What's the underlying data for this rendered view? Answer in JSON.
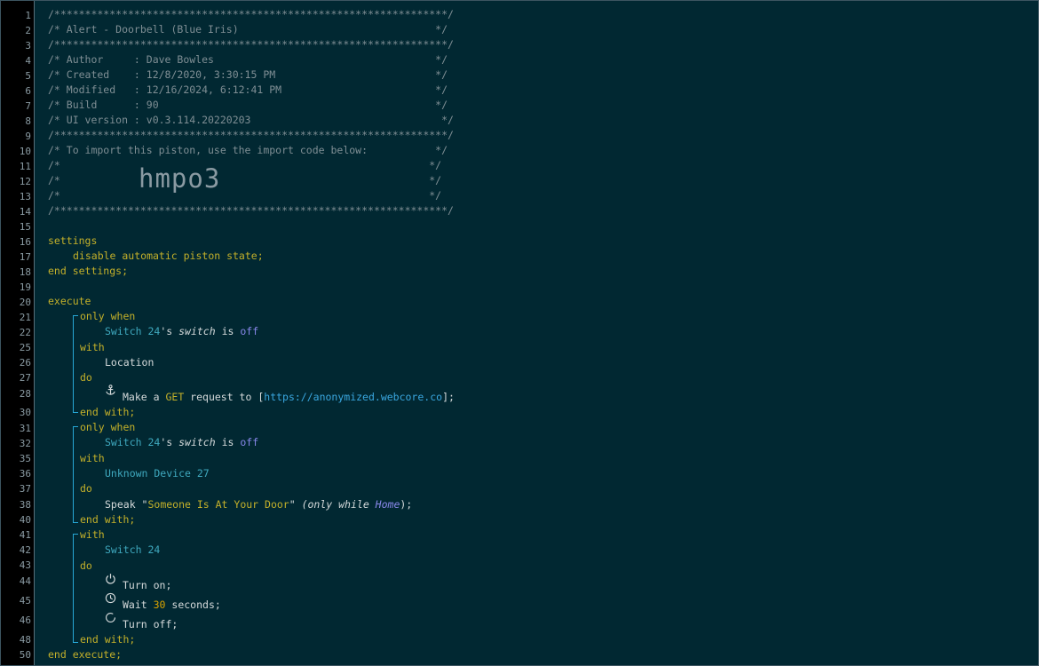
{
  "line_numbers": [
    "1",
    "2",
    "3",
    "4",
    "5",
    "6",
    "7",
    "8",
    "9",
    "10",
    "11",
    "12",
    "13",
    "14",
    "15",
    "16",
    "17",
    "18",
    "19",
    "20",
    "21",
    "22",
    "25",
    "26",
    "27",
    "28",
    "30",
    "31",
    "32",
    "35",
    "36",
    "37",
    "38",
    "40",
    "41",
    "42",
    "43",
    "44",
    "45",
    "46",
    "48",
    "50"
  ],
  "header": {
    "border": "/****************************************************************/",
    "title_line": "/* Alert - Doorbell (Blue Iris)                                */",
    "author_line": "/* Author     : Dave Bowles                                    */",
    "created_line": "/* Created    : 12/8/2020, 3:30:15 PM                          */",
    "modified_line": "/* Modified   : 12/16/2024, 6:12:41 PM                         */",
    "build_line": "/* Build      : 90                                             */",
    "ui_line": "/* UI version : v0.3.114.20220203                               */",
    "import_line": "/* To import this piston, use the import code below:           */",
    "blank_line": "/*                                                            */",
    "import_code": "hmpo3"
  },
  "settings": {
    "open": "settings",
    "body": "disable automatic piston state;",
    "close": "end settings;"
  },
  "execute": {
    "open": "execute",
    "close": "end execute;"
  },
  "block1": {
    "only_when": "only when",
    "device": "Switch 24",
    "possessive": "'s ",
    "attribute": "switch",
    "is": " is ",
    "value": "off",
    "with": "with",
    "target": "Location",
    "do": "do",
    "task_prefix": "Make a ",
    "method": "GET",
    "task_mid": " request to [",
    "url": "https://anonymized.webcore.co",
    "task_suffix": "];",
    "end": "end with;"
  },
  "block2": {
    "only_when": "only when",
    "device": "Switch 24",
    "possessive": "'s ",
    "attribute": "switch",
    "is": " is ",
    "value": "off",
    "with": "with",
    "target": "Unknown Device 27",
    "do": "do",
    "task_prefix": "Speak \"",
    "speech": "Someone Is At Your Door",
    "task_mid": "\" ",
    "only_while_prefix": "(only while ",
    "location_mode": "Home",
    "only_while_suffix": ");",
    "end": "end with;"
  },
  "block3": {
    "with": "with",
    "target": "Switch 24",
    "do": "do",
    "task1": "Turn on;",
    "task2_prefix": "Wait ",
    "task2_number": "30",
    "task2_suffix": " seconds;",
    "task3": "Turn off;",
    "end": "end with;"
  },
  "icons": {
    "task1": "anchor-icon",
    "power_on": "power-icon",
    "wait": "clock-icon",
    "power_off": "power-off-icon"
  }
}
